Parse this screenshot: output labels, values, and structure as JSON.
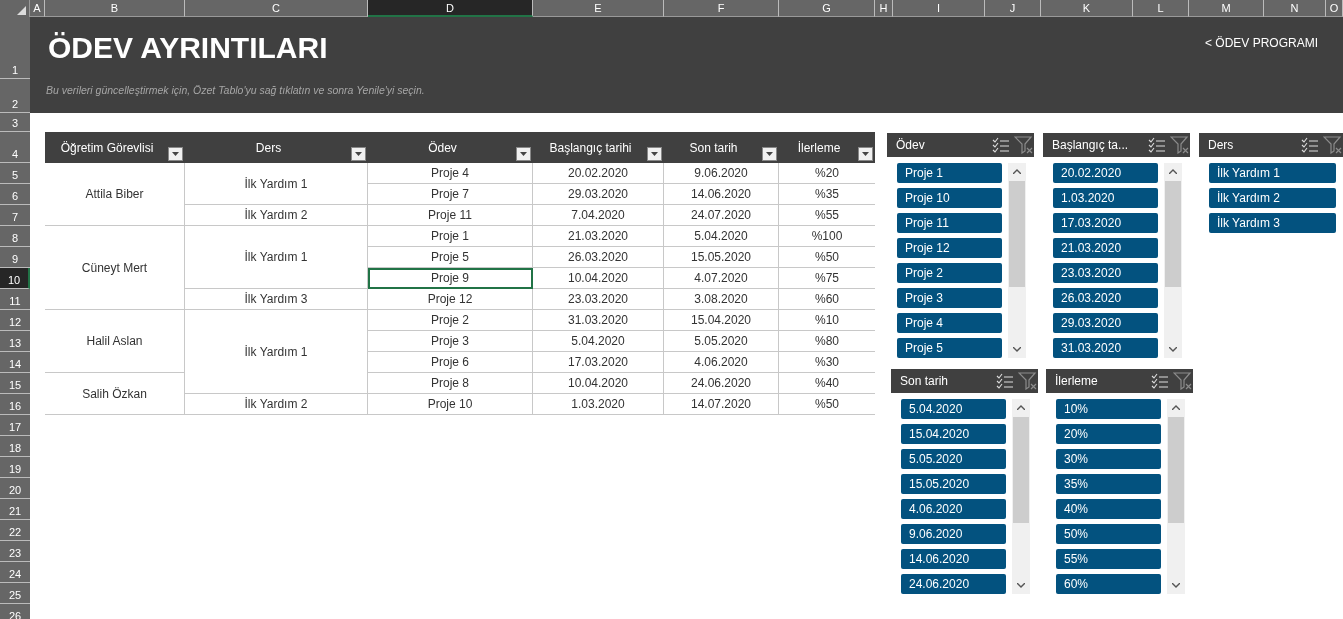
{
  "column_headers": [
    {
      "label": "A",
      "selected": false
    },
    {
      "label": "B",
      "selected": false
    },
    {
      "label": "C",
      "selected": false
    },
    {
      "label": "D",
      "selected": true
    },
    {
      "label": "E",
      "selected": false
    },
    {
      "label": "F",
      "selected": false
    },
    {
      "label": "G",
      "selected": false
    },
    {
      "label": "H",
      "selected": false
    },
    {
      "label": "I",
      "selected": false
    },
    {
      "label": "J",
      "selected": false
    },
    {
      "label": "K",
      "selected": false
    },
    {
      "label": "L",
      "selected": false
    },
    {
      "label": "M",
      "selected": false
    },
    {
      "label": "N",
      "selected": false
    },
    {
      "label": "O",
      "selected": false
    }
  ],
  "row_headers": [
    {
      "label": "1",
      "selected": false
    },
    {
      "label": "2",
      "selected": false
    },
    {
      "label": "3",
      "selected": false
    },
    {
      "label": "4",
      "selected": false
    },
    {
      "label": "5",
      "selected": false
    },
    {
      "label": "6",
      "selected": false
    },
    {
      "label": "7",
      "selected": false
    },
    {
      "label": "8",
      "selected": false
    },
    {
      "label": "9",
      "selected": false
    },
    {
      "label": "10",
      "selected": true
    },
    {
      "label": "11",
      "selected": false
    },
    {
      "label": "12",
      "selected": false
    },
    {
      "label": "13",
      "selected": false
    },
    {
      "label": "14",
      "selected": false
    },
    {
      "label": "15",
      "selected": false
    },
    {
      "label": "16",
      "selected": false
    },
    {
      "label": "17",
      "selected": false
    },
    {
      "label": "18",
      "selected": false
    },
    {
      "label": "19",
      "selected": false
    },
    {
      "label": "20",
      "selected": false
    },
    {
      "label": "21",
      "selected": false
    },
    {
      "label": "22",
      "selected": false
    },
    {
      "label": "23",
      "selected": false
    },
    {
      "label": "24",
      "selected": false
    },
    {
      "label": "25",
      "selected": false
    },
    {
      "label": "26",
      "selected": false
    }
  ],
  "banner": {
    "title": "ÖDEV AYRINTILARI",
    "link": "< ÖDEV PROGRAMI",
    "note": "Bu verileri güncelleştirmek için, Özet Tablo'yu sağ tıklatın ve sonra Yenile'yi seçin."
  },
  "pivot": {
    "columns": [
      "Öğretim Görevlisi",
      "Ders",
      "Ödev",
      "Başlangıç tarihi",
      "Son tarih",
      "İlerleme"
    ],
    "rows": [
      {
        "instructor": "Attila Biber",
        "course": "İlk Yardım 1",
        "task": "Proje 4",
        "start": "20.02.2020",
        "due": "9.06.2020",
        "progress": "%20",
        "selected": false
      },
      {
        "task": "Proje 7",
        "start": "29.03.2020",
        "due": "14.06.2020",
        "progress": "%35",
        "selected": false
      },
      {
        "course": "İlk Yardım 2",
        "task": "Proje 11",
        "start": "7.04.2020",
        "due": "24.07.2020",
        "progress": "%55",
        "selected": false
      },
      {
        "instructor": "Cüneyt Mert",
        "course": "İlk Yardım 1",
        "task": "Proje 1",
        "start": "21.03.2020",
        "due": "5.04.2020",
        "progress": "%100",
        "selected": false
      },
      {
        "task": "Proje 5",
        "start": "26.03.2020",
        "due": "15.05.2020",
        "progress": "%50",
        "selected": false
      },
      {
        "task": "Proje 9",
        "start": "10.04.2020",
        "due": "4.07.2020",
        "progress": "%75",
        "selected": true
      },
      {
        "course": "İlk Yardım 3",
        "task": "Proje 12",
        "start": "23.03.2020",
        "due": "3.08.2020",
        "progress": "%60",
        "selected": false
      },
      {
        "instructor": "Halil Aslan",
        "course": "İlk Yardım 1",
        "task": "Proje 2",
        "start": "31.03.2020",
        "due": "15.04.2020",
        "progress": "%10",
        "selected": false
      },
      {
        "task": "Proje 3",
        "start": "5.04.2020",
        "due": "5.05.2020",
        "progress": "%80",
        "selected": false
      },
      {
        "task": "Proje 6",
        "start": "17.03.2020",
        "due": "4.06.2020",
        "progress": "%30",
        "selected": false
      },
      {
        "instructor": "Salih Özkan",
        "task": "Proje 8",
        "start": "10.04.2020",
        "due": "24.06.2020",
        "progress": "%40",
        "selected": false
      },
      {
        "course": "İlk Yardım 2",
        "task": "Proje 10",
        "start": "1.03.2020",
        "due": "14.07.2020",
        "progress": "%50",
        "selected": false
      }
    ]
  },
  "slicers": [
    {
      "title": "Ödev",
      "scrollbar": true,
      "items": [
        {
          "label": "Proje 1",
          "selected": true
        },
        {
          "label": "Proje 10",
          "selected": true
        },
        {
          "label": "Proje 11",
          "selected": true
        },
        {
          "label": "Proje 12",
          "selected": true
        },
        {
          "label": "Proje 2",
          "selected": true
        },
        {
          "label": "Proje 3",
          "selected": true
        },
        {
          "label": "Proje 4",
          "selected": true
        },
        {
          "label": "Proje 5",
          "selected": true
        }
      ]
    },
    {
      "title": "Başlangıç ta...",
      "scrollbar": true,
      "items": [
        {
          "label": "20.02.2020",
          "selected": true
        },
        {
          "label": "1.03.2020",
          "selected": true
        },
        {
          "label": "17.03.2020",
          "selected": true
        },
        {
          "label": "21.03.2020",
          "selected": true
        },
        {
          "label": "23.03.2020",
          "selected": true
        },
        {
          "label": "26.03.2020",
          "selected": true
        },
        {
          "label": "29.03.2020",
          "selected": true
        },
        {
          "label": "31.03.2020",
          "selected": true
        }
      ]
    },
    {
      "title": "Ders",
      "scrollbar": false,
      "items": [
        {
          "label": "İlk Yardım 1",
          "selected": true
        },
        {
          "label": "İlk Yardım 2",
          "selected": true
        },
        {
          "label": "İlk Yardım 3",
          "selected": true
        }
      ]
    },
    {
      "title": "Son tarih",
      "scrollbar": true,
      "items": [
        {
          "label": "5.04.2020",
          "selected": true
        },
        {
          "label": "15.04.2020",
          "selected": true
        },
        {
          "label": "5.05.2020",
          "selected": true
        },
        {
          "label": "15.05.2020",
          "selected": true
        },
        {
          "label": "4.06.2020",
          "selected": true
        },
        {
          "label": "9.06.2020",
          "selected": true
        },
        {
          "label": "14.06.2020",
          "selected": true
        },
        {
          "label": "24.06.2020",
          "selected": true
        }
      ]
    },
    {
      "title": "İlerleme",
      "scrollbar": true,
      "items": [
        {
          "label": "10%",
          "selected": true
        },
        {
          "label": "20%",
          "selected": true
        },
        {
          "label": "30%",
          "selected": true
        },
        {
          "label": "35%",
          "selected": true
        },
        {
          "label": "40%",
          "selected": true
        },
        {
          "label": "50%",
          "selected": true
        },
        {
          "label": "55%",
          "selected": true
        },
        {
          "label": "60%",
          "selected": true
        }
      ]
    }
  ]
}
